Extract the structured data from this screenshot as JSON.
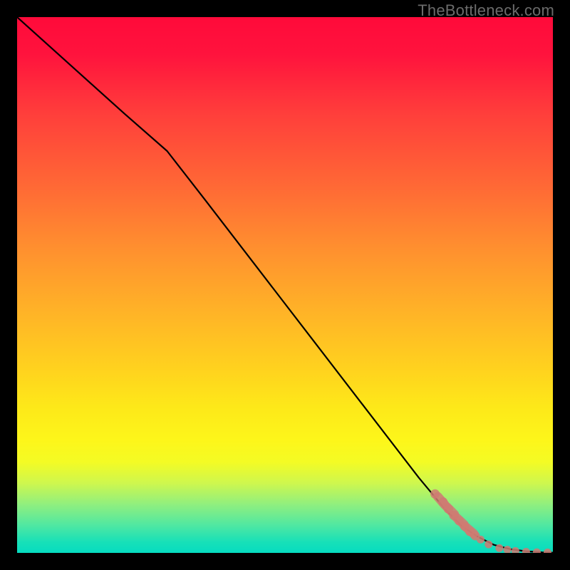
{
  "watermark": "TheBottleneck.com",
  "chart_data": {
    "type": "line",
    "title": "",
    "xlabel": "",
    "ylabel": "",
    "xlim": [
      0,
      100
    ],
    "ylim": [
      0,
      100
    ],
    "series": [
      {
        "name": "curve",
        "style": "black-line",
        "x": [
          0,
          10,
          20,
          28,
          35,
          45,
          55,
          65,
          75,
          80,
          83,
          86,
          89,
          92,
          95,
          98,
          100
        ],
        "y": [
          100,
          91,
          82,
          75,
          66,
          53,
          40,
          27,
          14,
          8,
          5,
          3,
          1.5,
          0.7,
          0.3,
          0.1,
          0.05
        ]
      },
      {
        "name": "data-points",
        "style": "salmon-dots",
        "x": [
          78,
          79.5,
          80.5,
          81.5,
          82.5,
          83.5,
          84.5,
          85.5,
          86.5,
          88,
          90,
          91.5,
          93,
          95,
          97,
          99
        ],
        "y": [
          11,
          9.5,
          8.2,
          7,
          6,
          5,
          4,
          3.2,
          2.5,
          1.6,
          0.9,
          0.6,
          0.35,
          0.2,
          0.12,
          0.08
        ]
      }
    ],
    "colors": {
      "line": "#000000",
      "dots": "#cf7a72",
      "gradient_top": "#ff0a3a",
      "gradient_bottom": "#06dcc0",
      "background": "#000000",
      "watermark": "#6b6b6b"
    }
  }
}
